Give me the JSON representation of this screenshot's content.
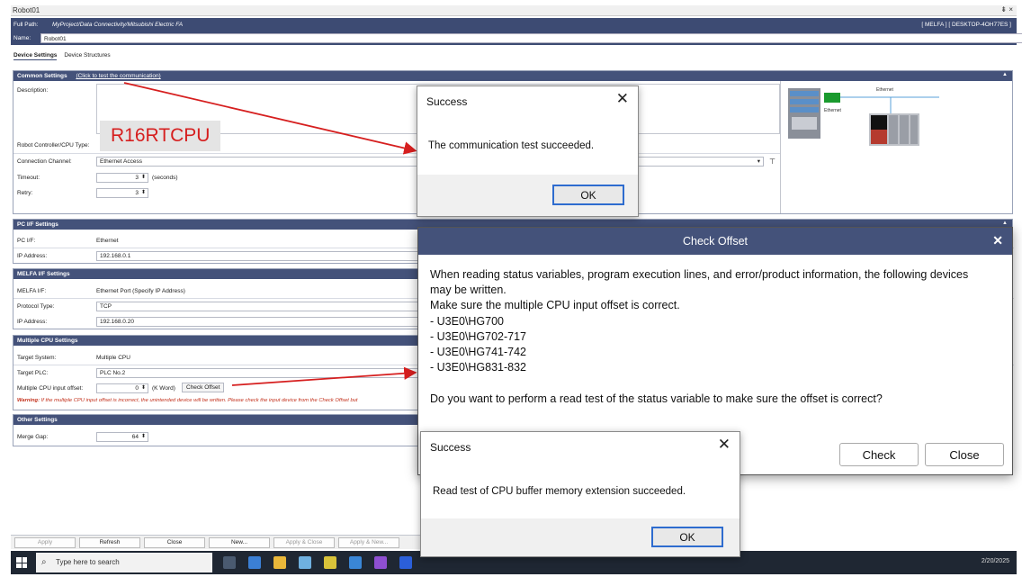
{
  "window": {
    "title": "Robot01",
    "controls": "⇟ ×",
    "full_path_label": "Full Path:",
    "full_path": "MyProject/Data Connectivity/Mitsubishi Electric FA",
    "path_right": "[ MELFA ] [ DESKTOP-4OH77ES ]",
    "name_label": "Name:",
    "name_value": "Robot01"
  },
  "tabs": [
    {
      "label": "Device Settings",
      "active": true
    },
    {
      "label": "Device Structures",
      "active": false
    }
  ],
  "common": {
    "header": "Common Settings",
    "link": "(Click to test the communication)",
    "description_label": "Description:",
    "cpu_type_label": "Robot Controller/CPU Type:",
    "annotation": "R16RTCPU",
    "channel_label": "Connection Channel:",
    "channel_value": "Ethernet Access",
    "timeout_label": "Timeout:",
    "timeout_value": "3",
    "timeout_unit": "(seconds)",
    "retry_label": "Retry:",
    "retry_value": "3",
    "diagram_label_top": "Ethernet",
    "diagram_label_left": "Ethernet"
  },
  "pc_if": {
    "header": "PC I/F Settings",
    "pcif_label": "PC I/F:",
    "pcif_value": "Ethernet",
    "ip_label": "IP Address:",
    "ip_value": "192.168.0.1"
  },
  "melfa_if": {
    "header": "MELFA I/F Settings",
    "melfa_label": "MELFA I/F:",
    "melfa_value": "Ethernet Port (Specify IP Address)",
    "protocol_label": "Protocol Type:",
    "protocol_value": "TCP",
    "ip_label": "IP Address:",
    "ip_value": "192.168.0.20"
  },
  "multi_cpu": {
    "header": "Multiple CPU Settings",
    "system_label": "Target System:",
    "system_value": "Multiple CPU",
    "plc_label": "Target PLC:",
    "plc_value": "PLC No.2",
    "offset_label": "Multiple CPU input offset:",
    "offset_value": "0",
    "offset_unit": "(K Word)",
    "check_offset_label": "Check Offset",
    "warning_prefix": "Warning:",
    "warning_text": "If the multiple CPU input offset is incorrect, the unintended device will be written. Please check the input device from the Check Offset but"
  },
  "other": {
    "header": "Other Settings",
    "merge_label": "Merge Gap:",
    "merge_value": "64"
  },
  "bottom_buttons": [
    {
      "label": "Apply",
      "disabled": true
    },
    {
      "label": "Refresh",
      "disabled": false
    },
    {
      "label": "Close",
      "disabled": false
    },
    {
      "label": "New...",
      "disabled": false
    },
    {
      "label": "Apply & Close",
      "disabled": true
    },
    {
      "label": "Apply & New...",
      "disabled": true
    }
  ],
  "taskbar": {
    "search_placeholder": "Type here to search",
    "date": "2/20/2025"
  },
  "dialog_success_1": {
    "title": "Success",
    "message": "The communication test succeeded.",
    "ok": "OK"
  },
  "dialog_check_offset": {
    "title": "Check Offset",
    "lines": [
      "When reading status variables, program execution lines, and error/product information, the following devices",
      "may be written.",
      "Make sure the multiple CPU input offset is correct.",
      "- U3E0\\HG700",
      "- U3E0\\HG702-717",
      "- U3E0\\HG741-742",
      "- U3E0\\HG831-832",
      "",
      "Do you want to perform a read test of the status variable to make sure the offset is correct?"
    ],
    "check": "Check",
    "close": "Close"
  },
  "dialog_success_2": {
    "title": "Success",
    "message": "Read test of CPU buffer memory extension succeeded.",
    "ok": "OK"
  },
  "colors": {
    "header": "#44527a",
    "annotation_red": "#d61f1f",
    "warning": "#c3311c",
    "focus_blue": "#2e6ccf"
  }
}
